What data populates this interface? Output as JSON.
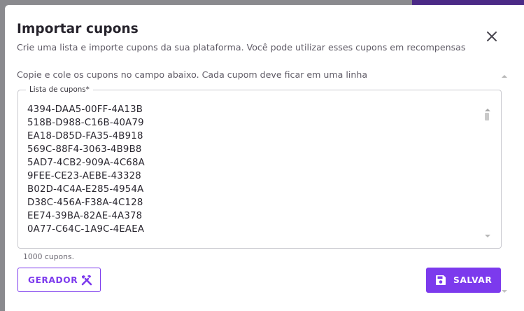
{
  "dialog": {
    "title": "Importar cupons",
    "subtitle": "Crie uma lista e importe cupons da sua plataforma. Você pode utilizar esses cupons em recompensas",
    "instruction": "Copie e cole os cupons no campo abaixo. Cada cupom deve ficar em uma linha",
    "close_icon": "close-icon"
  },
  "coupon_field": {
    "label": "Lista de cupons*",
    "lines": [
      "4394-DAA5-00FF-4A13B",
      "518B-D988-C16B-40A79",
      "EA18-D85D-FA35-4B918",
      "569C-88F4-3063-4B9B8",
      "5AD7-4CB2-909A-4C68A",
      "9FEE-CE23-AEBE-43328",
      "B02D-4C4A-E285-4954A",
      "D38C-456A-F38A-4C128",
      "EE74-39BA-82AE-4A378",
      "0A77-C64C-1A9C-4EAEA"
    ],
    "count_text": "1000 cupons."
  },
  "actions": {
    "generator_label": "GERADOR",
    "generator_icon": "tools-icon",
    "save_label": "SALVAR",
    "save_icon": "floppy-disk-icon"
  },
  "colors": {
    "accent": "#7c3aed",
    "title": "#25222b",
    "muted": "#5f5b66",
    "border": "#c9c9cf"
  }
}
